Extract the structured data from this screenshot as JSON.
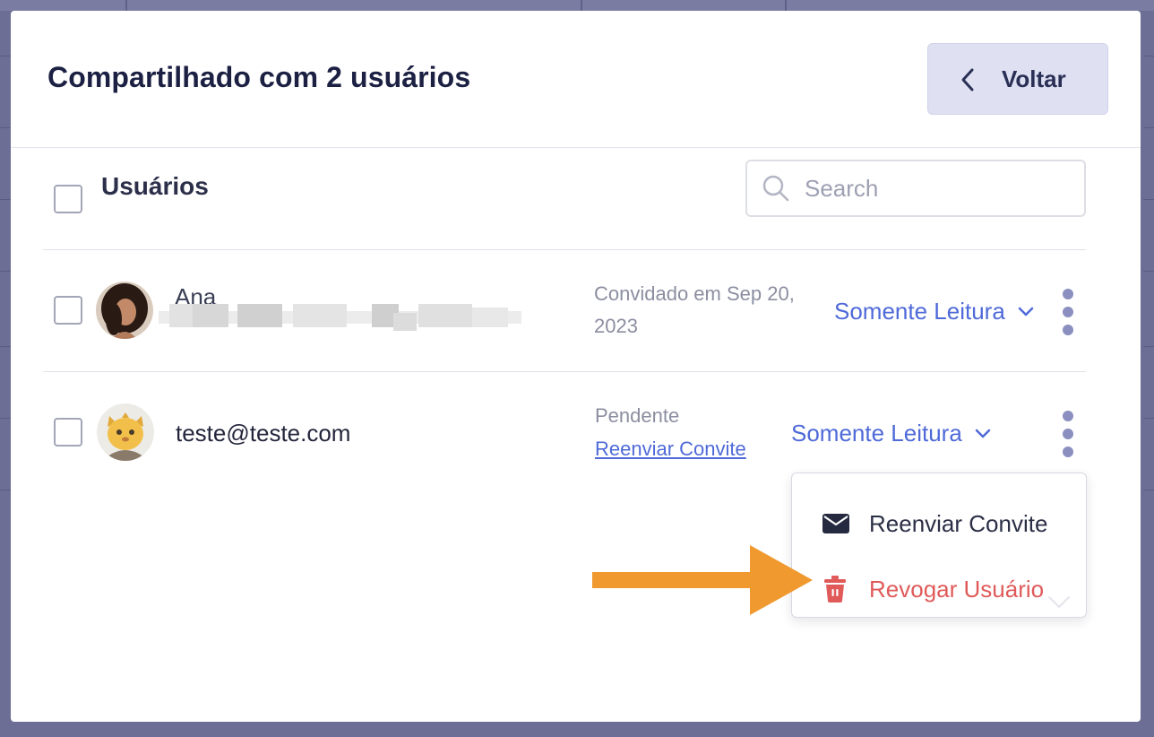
{
  "modal": {
    "title": "Compartilhado com 2 usuários",
    "back_label": "Voltar"
  },
  "list": {
    "heading": "Usuários",
    "search_placeholder": "Search"
  },
  "users": [
    {
      "name": "Ana",
      "status_text": "Convidado em Sep 20, 2023",
      "status_line1": "Convidado em Sep 20,",
      "status_line2": "2023",
      "role": "Somente Leitura"
    },
    {
      "email": "teste@teste.com",
      "status_text": "Pendente",
      "resend_link": "Reenviar Convite",
      "role": "Somente Leitura"
    }
  ],
  "menu": {
    "items": [
      {
        "label": "Reenviar Convite",
        "icon": "envelope-icon"
      },
      {
        "label": "Revogar Usuário",
        "icon": "trash-icon"
      }
    ]
  },
  "colors": {
    "accent": "#4f6ad8",
    "danger": "#e05a5a",
    "annotation_arrow": "#f0992e"
  }
}
